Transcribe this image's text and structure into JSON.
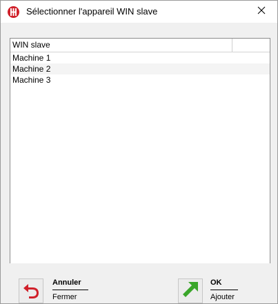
{
  "window": {
    "title": "Sélectionner l'appareil WIN slave"
  },
  "list": {
    "columns": [
      "WIN slave",
      ""
    ],
    "rows": [
      "Machine 1",
      "Machine 2",
      "Machine 3"
    ]
  },
  "buttons": {
    "cancel": {
      "label": "Annuler",
      "sub": "Fermer",
      "icon": "undo-arrow-icon"
    },
    "ok": {
      "label": "OK",
      "sub": "Ajouter",
      "icon": "green-arrow-icon"
    }
  },
  "colors": {
    "icon_red": "#d0202a",
    "ok_green": "#3aa62a"
  }
}
